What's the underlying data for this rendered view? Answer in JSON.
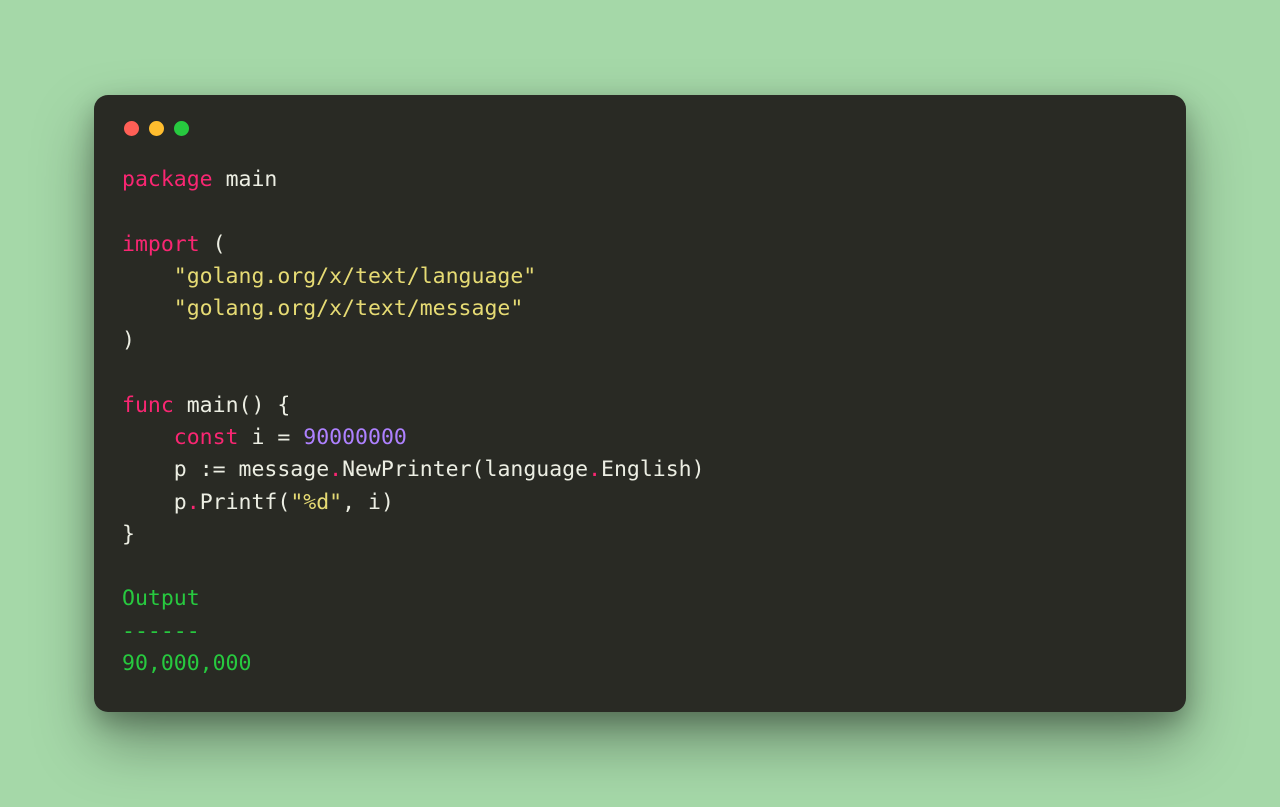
{
  "code": {
    "kw_package": "package",
    "pkg_name": "main",
    "kw_import": "import",
    "import1": "\"golang.org/x/text/language\"",
    "import2": "\"golang.org/x/text/message\"",
    "kw_func": "func",
    "func_name": "main",
    "kw_const": "const",
    "var_i": "i",
    "const_val": "90000000",
    "var_p": "p",
    "assign": ":=",
    "msg_pkg": "message",
    "newprinter": "NewPrinter",
    "lang_pkg": "language",
    "english": "English",
    "printf": "Printf",
    "fmt_str": "\"%d\"",
    "arg_i": "i",
    "paren_open": "(",
    "paren_close": ")",
    "brace_open": "{",
    "brace_close": "}",
    "eq": "=",
    "comma": ",",
    "dot": "."
  },
  "output": {
    "label": "Output",
    "divider": "------",
    "value": "90,000,000"
  }
}
